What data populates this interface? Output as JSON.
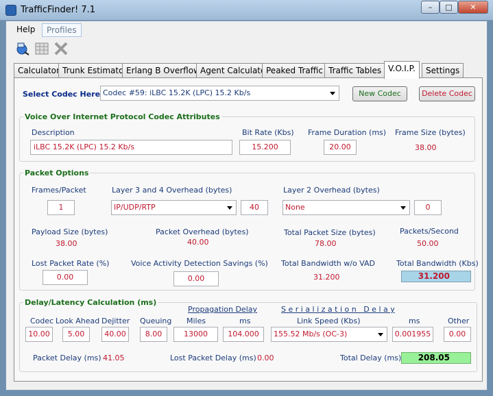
{
  "window": {
    "title": "TrafficFinder! 7.1",
    "minimize": "–",
    "maximize": "□",
    "close": "✕"
  },
  "menu": {
    "help": "Help",
    "profiles": "Profiles"
  },
  "toolbar": {
    "icons": [
      "disk-icon",
      "table-icon",
      "excel-icon"
    ]
  },
  "tabs": [
    "Calculator",
    "Trunk Estimator",
    "Erlang B Overflow",
    "Agent Calculator",
    "Peaked Traffic",
    "Traffic Tables",
    "V.O.I.P.",
    "Settings"
  ],
  "active_tab": "V.O.I.P.",
  "codec": {
    "select_label": "Select Codec Here:",
    "selected": "Codec #59: iLBC 15.2K (LPC) 15.2 Kb/s",
    "new_button": "New Codec",
    "delete_button": "Delete Codec"
  },
  "attributes": {
    "title": "Voice Over Internet Protocol Codec Attributes",
    "description_label": "Description",
    "description": "iLBC 15.2K (LPC) 15.2 Kb/s",
    "bitrate_label": "Bit Rate (Kbs)",
    "bitrate": "15.200",
    "frame_duration_label": "Frame Duration (ms)",
    "frame_duration": "20.00",
    "frame_size_label": "Frame Size (bytes)",
    "frame_size": "38.00"
  },
  "packet": {
    "title": "Packet Options",
    "frames_label": "Frames/Packet",
    "frames": "1",
    "l34_label": "Layer 3 and 4 Overhead (bytes)",
    "l34_select": "IP/UDP/RTP",
    "l34_value": "40",
    "l2_label": "Layer 2 Overhead (bytes)",
    "l2_select": "None",
    "l2_value": "0",
    "payload_label": "Payload Size (bytes)",
    "payload": "38.00",
    "overhead_label": "Packet Overhead (bytes)",
    "overhead": "40.00",
    "total_size_label": "Total Packet Size (bytes)",
    "total_size": "78.00",
    "pps_label": "Packets/Second",
    "pps": "50.00",
    "lost_label": "Lost Packet Rate (%)",
    "lost": "0.00",
    "vad_label": "Voice Activity Detection Savings (%)",
    "vad": "0.00",
    "bw_novad_label": "Total Bandwidth w/o VAD",
    "bw_novad": "31.200",
    "bw_label": "Total Bandwidth (Kbs)",
    "bw": "31.200"
  },
  "delay": {
    "title": "Delay/Latency Calculation (ms)",
    "propagation_label": "Propagation Delay",
    "serialization_label": "S e r i a l i z a t i o n   D e l a y",
    "codec_label": "Codec",
    "codec": "10.00",
    "lookahead_label": "Look Ahead",
    "lookahead": "5.00",
    "dejitter_label": "Dejitter",
    "dejitter": "40.00",
    "queuing_label": "Queuing",
    "queuing": "8.00",
    "miles_label": "Miles",
    "miles": "13000",
    "ms_label": "ms",
    "prop_ms": "104.000",
    "link_label": "Link Speed (Kbs)",
    "link": "155.52 Mb/s (OC-3)",
    "ser_ms_label": "ms",
    "ser_ms": "0.001955",
    "other_label": "Other",
    "other": "0.00",
    "packet_delay_label": "Packet Delay (ms)",
    "packet_delay": "41.05",
    "lost_delay_label": "Lost Packet Delay (ms)",
    "lost_delay": "0.00",
    "total_label": "Total Delay (ms)",
    "total": "208.05"
  },
  "colors": {
    "title_bar": "#9fbad6",
    "bandwidth_bg": "#a8d4e8",
    "total_bg": "#98f098",
    "accent_green": "#1b6e1b",
    "value_red": "#c0182e"
  }
}
